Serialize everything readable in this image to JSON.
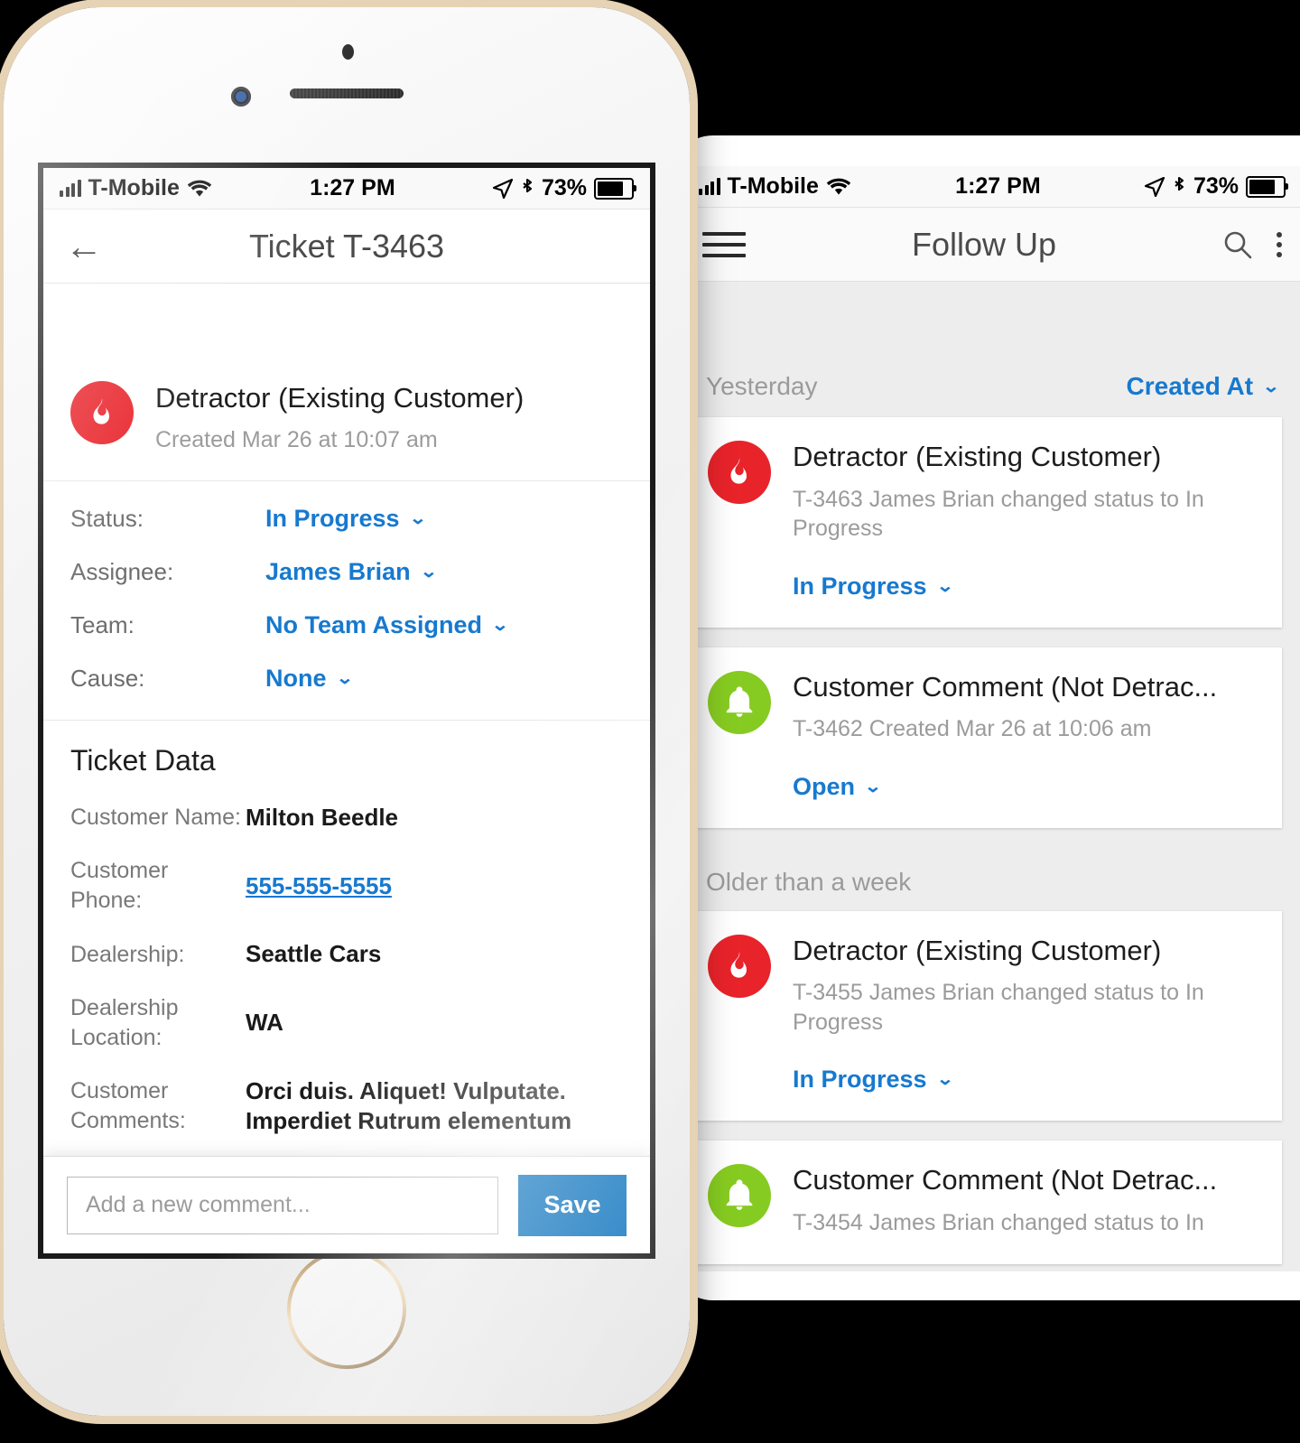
{
  "status_bar": {
    "carrier": "T-Mobile",
    "time": "1:27 PM",
    "battery_pct": "73%",
    "icons": [
      "signal-bars-icon",
      "wifi-icon",
      "location-arrow-icon",
      "bluetooth-icon",
      "battery-icon"
    ]
  },
  "colors": {
    "accent_blue": "#1779cf",
    "save_button": "#0b72bd",
    "detractor_red": "#e8232a",
    "comment_green": "#86cb21",
    "label_gray": "#787878"
  },
  "ticket_detail": {
    "nav": {
      "back_icon": "back-arrow-icon",
      "title": "Ticket T-3463"
    },
    "header": {
      "icon": "flame-icon",
      "title": "Detractor (Existing Customer)",
      "subtitle": "Created Mar 26 at 10:07 am"
    },
    "fields": [
      {
        "label": "Status:",
        "value": "In Progress"
      },
      {
        "label": "Assignee:",
        "value": "James Brian"
      },
      {
        "label": "Team:",
        "value": "No Team Assigned"
      },
      {
        "label": "Cause:",
        "value": "None"
      }
    ],
    "ticket_data": {
      "heading": "Ticket Data",
      "rows": [
        {
          "label": "Customer Name:",
          "value": "Milton Beedle",
          "is_link": false
        },
        {
          "label": "Customer Phone:",
          "value": "555-555-5555",
          "is_link": true
        },
        {
          "label": "Dealership:",
          "value": "Seattle Cars",
          "is_link": false
        },
        {
          "label": "Dealership Location:",
          "value": "WA",
          "is_link": false
        },
        {
          "label": "Customer Comments:",
          "value": "Orci duis. Aliquet! Vulputate. Imperdiet Rutrum elementum",
          "is_link": false
        }
      ]
    },
    "composer": {
      "placeholder": "Add a new comment...",
      "input_value": "",
      "save_label": "Save"
    }
  },
  "follow_up": {
    "nav": {
      "menu_icon": "hamburger-menu-icon",
      "title": "Follow Up",
      "search_icon": "search-icon",
      "overflow_icon": "more-vertical-icon"
    },
    "sort": {
      "group_label": "Yesterday",
      "sort_label": "Created At"
    },
    "sections": [
      {
        "label": "Yesterday",
        "show_label": false,
        "cards": [
          {
            "icon": "flame-icon",
            "icon_color": "#e8232a",
            "title": "Detractor (Existing Customer)",
            "subtitle": "T-3463 James Brian changed status to In Progress",
            "status": "In Progress"
          },
          {
            "icon": "bell-icon",
            "icon_color": "#86cb21",
            "title": "Customer Comment (Not Detrac...",
            "subtitle": "T-3462 Created Mar 26 at 10:06 am",
            "status": "Open"
          }
        ]
      },
      {
        "label": "Older than a week",
        "show_label": true,
        "cards": [
          {
            "icon": "flame-icon",
            "icon_color": "#e8232a",
            "title": "Detractor (Existing Customer)",
            "subtitle": "T-3455 James Brian changed status to In Progress",
            "status": "In Progress"
          },
          {
            "icon": "bell-icon",
            "icon_color": "#86cb21",
            "title": "Customer Comment (Not Detrac...",
            "subtitle": "T-3454 James Brian changed status to In",
            "status": ""
          }
        ]
      }
    ]
  }
}
